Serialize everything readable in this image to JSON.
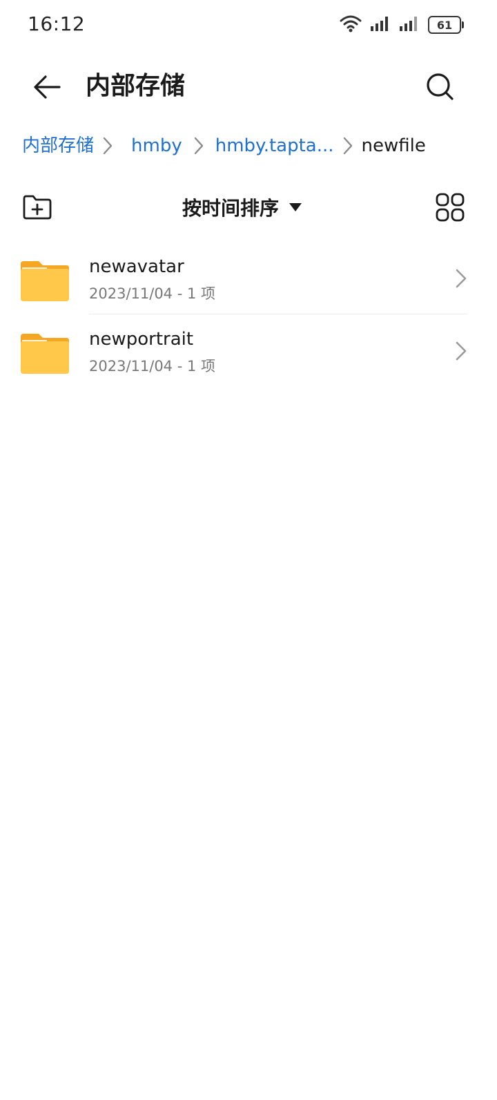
{
  "status_bar": {
    "time": "16:12",
    "battery": "61",
    "icons": [
      "wifi-icon",
      "signal-icon",
      "signal-icon",
      "battery-icon"
    ]
  },
  "header": {
    "title": "内部存储",
    "back_icon": "arrow-left-icon",
    "search_icon": "search-icon"
  },
  "breadcrumb": {
    "items": [
      {
        "label": "内部存储",
        "current": false
      },
      {
        "label": "hmby",
        "current": false
      },
      {
        "label": "hmby.tapta...",
        "current": false
      },
      {
        "label": "newfile",
        "current": true
      }
    ]
  },
  "toolbar": {
    "sort_label": "按时间排序",
    "new_folder_icon": "folder-add-icon",
    "grid_icon": "grid-view-icon"
  },
  "files": [
    {
      "name": "newavatar",
      "meta": "2023/11/04 - 1 项"
    },
    {
      "name": "newportrait",
      "meta": "2023/11/04 - 1 项"
    }
  ],
  "colors": {
    "accent": "#1f6fd1",
    "folder": "#ffc84a",
    "folder_tab": "#f5a623"
  }
}
